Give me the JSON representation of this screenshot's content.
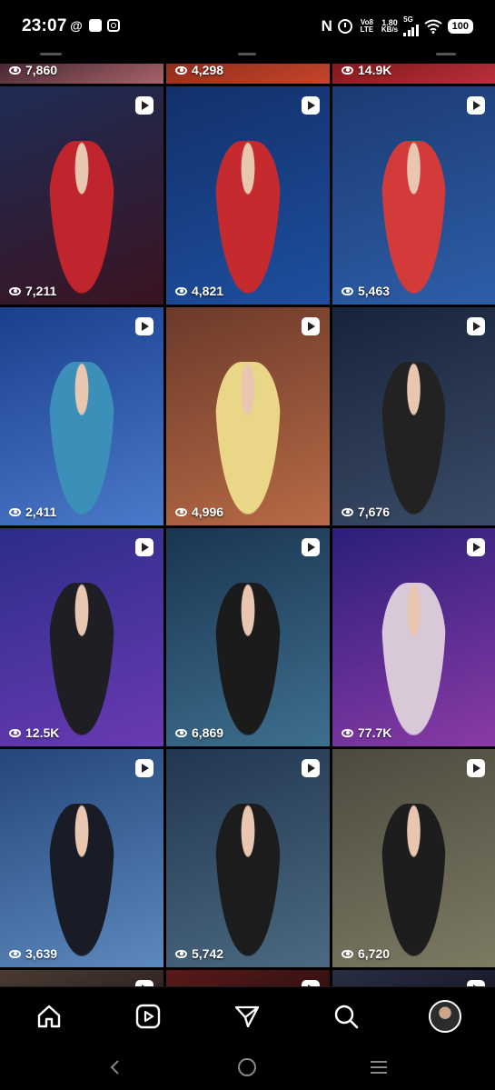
{
  "status_bar": {
    "time": "23:07",
    "network_label": "Vo8 LTE",
    "speed_value": "1.80",
    "speed_unit": "KB/s",
    "signal_label": "5G",
    "battery": "100"
  },
  "grid": {
    "top_row_views": [
      "7,860",
      "4,298",
      "14.9K"
    ],
    "tiles": [
      {
        "views": "7,211",
        "is_reel": true,
        "colors": [
          "#1e2c55",
          "#3a1320"
        ],
        "figure": "#c0242c"
      },
      {
        "views": "4,821",
        "is_reel": true,
        "colors": [
          "#12306b",
          "#1e4f9e"
        ],
        "figure": "#c52a2f"
      },
      {
        "views": "5,463",
        "is_reel": true,
        "colors": [
          "#1b3a73",
          "#2e5ea8"
        ],
        "figure": "#d33a3a"
      },
      {
        "views": "2,411",
        "is_reel": true,
        "colors": [
          "#1a3f8c",
          "#4b79c9"
        ],
        "figure": "#3b8fb8"
      },
      {
        "views": "4,996",
        "is_reel": true,
        "colors": [
          "#6b3a2a",
          "#b86a46"
        ],
        "figure": "#e9d686"
      },
      {
        "views": "7,676",
        "is_reel": true,
        "colors": [
          "#17233c",
          "#3b4b66"
        ],
        "figure": "#222222"
      },
      {
        "views": "12.5K",
        "is_reel": true,
        "colors": [
          "#2b2d88",
          "#6a3ab3"
        ],
        "figure": "#1e1e24"
      },
      {
        "views": "6,869",
        "is_reel": true,
        "colors": [
          "#1a3550",
          "#3e6f8f"
        ],
        "figure": "#1b1b1b"
      },
      {
        "views": "77.7K",
        "is_reel": true,
        "colors": [
          "#2a1f7a",
          "#8a3aa6"
        ],
        "figure": "#d8c8d8"
      },
      {
        "views": "3,639",
        "is_reel": true,
        "colors": [
          "#24467a",
          "#5c89bd"
        ],
        "figure": "#191c26"
      },
      {
        "views": "5,742",
        "is_reel": true,
        "colors": [
          "#22364f",
          "#4b6a82"
        ],
        "figure": "#1c1c1c"
      },
      {
        "views": "6,720",
        "is_reel": true,
        "colors": [
          "#4b4a3e",
          "#7d7a63"
        ],
        "figure": "#1d1d1d"
      }
    ]
  },
  "bottom_nav": {
    "items": [
      "home-icon",
      "reels-icon",
      "direct-message-icon",
      "search-icon",
      "profile-avatar"
    ]
  },
  "system_nav": {
    "items": [
      "back-icon",
      "home-circle-icon",
      "recents-icon"
    ]
  }
}
